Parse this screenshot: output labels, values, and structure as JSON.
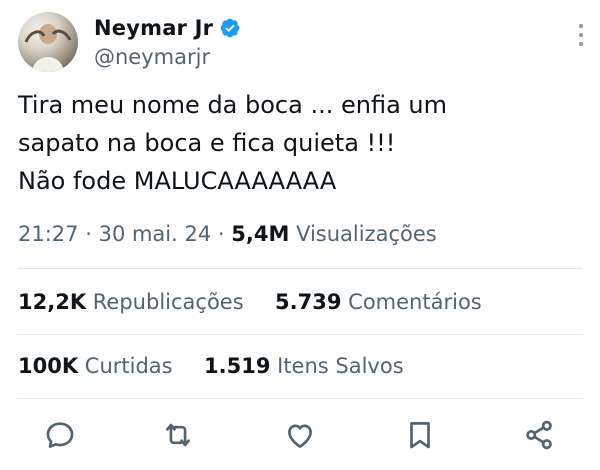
{
  "author": {
    "name": "Neymar Jr",
    "handle": "@neymarjr"
  },
  "tweet": {
    "text": "Tira meu nome da boca ... enfia um\nsapato na boca e fica quieta !!!\nNão fode MALUCAAAAAAA"
  },
  "meta": {
    "time": "21:27",
    "date": "30 mai. 24",
    "views_count": "5,4M",
    "views_label": "Visualizações"
  },
  "stats": {
    "reposts_count": "12,2K",
    "reposts_label": "Republicações",
    "comments_count": "5.739",
    "comments_label": "Comentários",
    "likes_count": "100K",
    "likes_label": "Curtidas",
    "saves_count": "1.519",
    "saves_label": "Itens Salvos"
  },
  "actions": [
    "comment-icon",
    "repost-icon",
    "like-icon",
    "bookmark-icon",
    "share-icon"
  ],
  "colors": {
    "verified": "#1d9bf0",
    "secondary_text": "#536471",
    "primary_text": "#0f1419",
    "action_icon": "#536471",
    "divider": "#e1e8ed"
  }
}
